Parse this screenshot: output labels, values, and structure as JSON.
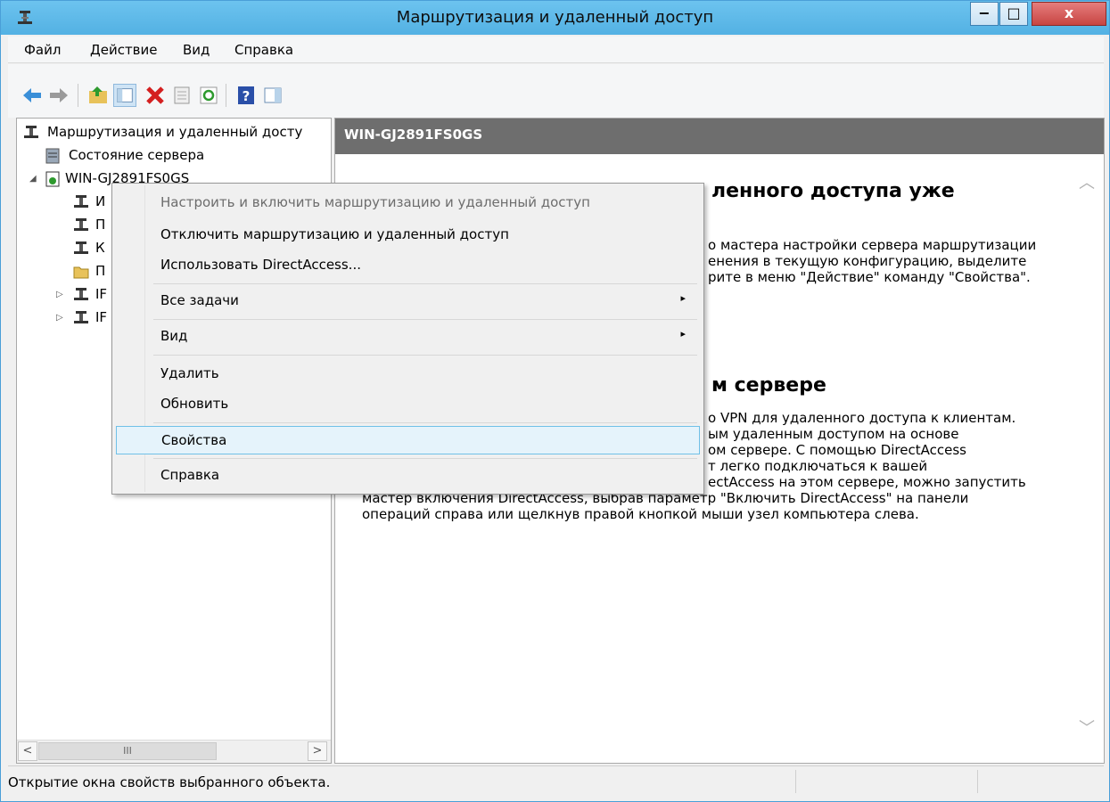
{
  "window": {
    "title": "Маршрутизация и удаленный доступ",
    "buttons": {
      "minimize": "−",
      "maximize": "□",
      "close": "x"
    }
  },
  "menubar": [
    "Файл",
    "Действие",
    "Вид",
    "Справка"
  ],
  "toolbar": {
    "icons": [
      "back-arrow-icon",
      "forward-arrow-icon",
      "up-folder-icon",
      "show-hide-tree-icon",
      "delete-icon",
      "properties-icon",
      "refresh-icon",
      "help-icon",
      "action-pane-icon"
    ]
  },
  "tree": {
    "root": "Маршрутизация и удаленный досту",
    "items": [
      {
        "label": "Состояние сервера"
      },
      {
        "label": "WIN-GJ2891FS0GS"
      },
      {
        "label": "И"
      },
      {
        "label": "П"
      },
      {
        "label": "К"
      },
      {
        "label": "П"
      },
      {
        "label": "IF"
      },
      {
        "label": "IF"
      }
    ],
    "scroll": {
      "left": "<",
      "right": ">",
      "thumb": "III"
    }
  },
  "right_pane": {
    "header": "WIN-GJ2891FS0GS",
    "heading1": "ленного доступа уже",
    "para1": [
      "о мастера настройки сервера маршрутизации",
      "енения в текущую конфигурацию, выделите",
      "рите в меню \"Действие\" команду \"Свойства\"."
    ],
    "heading2": "м сервере",
    "para2": [
      "о VPN для удаленного доступа к клиентам.",
      "ым удаленным доступом на основе",
      "ом сервере. С помощью DirectAccess",
      "т легко подключаться к вашей",
      "ectAccess на этом сервере, можно запустить",
      "мастер включения DirectAccess, выбрав параметр \"Включить DirectAccess\" на панели",
      "операций справа или щелкнув правой кнопкой мыши узел компьютера слева."
    ]
  },
  "context_menu": {
    "items": [
      {
        "label": "Настроить и включить маршрутизацию и удаленный доступ",
        "disabled": true
      },
      {
        "label": "Отключить маршрутизацию и удаленный доступ"
      },
      {
        "label": "Использовать DirectAccess..."
      },
      {
        "label": "Все задачи",
        "submenu": true
      },
      {
        "label": "Вид",
        "submenu": true
      },
      {
        "label": "Удалить"
      },
      {
        "label": "Обновить"
      },
      {
        "label": "Свойства",
        "selected": true
      },
      {
        "label": "Справка"
      }
    ],
    "submenu_arrow": "▸"
  },
  "statusbar": {
    "text": "Открытие окна свойств выбранного объекта."
  },
  "colors": {
    "titlebar": "#5cb8e8",
    "header": "#6e6e6e",
    "selection": "#e5f3fb",
    "selection_border": "#70c0e7"
  }
}
